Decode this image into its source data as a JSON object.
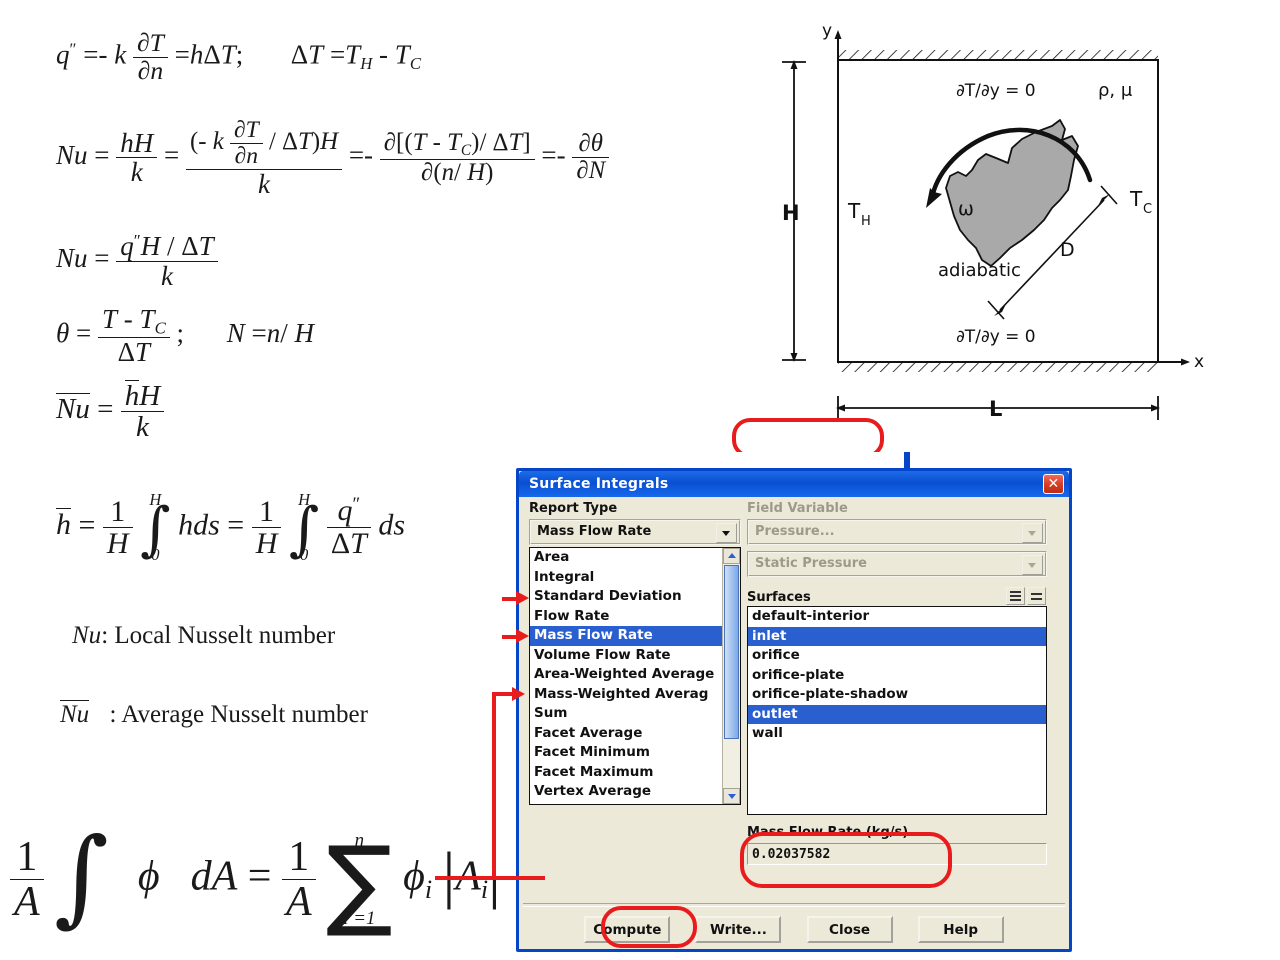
{
  "equations": {
    "eq1": "q″ = -k ∂T/∂n = hΔT;   ΔT = T_H - T_C",
    "eq2": "Nu = hH/k = (-k ∂T/∂n / ΔT)H / k = -∂[(T - T_C)/ΔT] / ∂(n/H) = -∂θ/∂N",
    "eq3": "Nu = q″H/ΔT / k",
    "eq4": "θ = (T - T_C)/ΔT;   N = n/H",
    "eq5": "Nu̅ = h̅H/k",
    "eq6": "h̅ = (1/H)∫₀^H h ds = (1/H)∫₀^H (q″/ΔT) ds",
    "eq7": "(1/A)∫ φ dA = (1/A)Σ_{i=1}^{n} φ_i |A_i|",
    "sym": {
      "q": "q",
      "k": "k",
      "h": "h",
      "H": "H",
      "T": "T",
      "n": "n",
      "N": "N",
      "Nu": "Nu",
      "theta": "θ",
      "dT": "ΔT",
      "partial": "∂",
      "TH": "H",
      "TC": "C",
      "phi": "ϕ",
      "A": "A",
      "ds": "ds",
      "dA": "dA",
      "i": "i",
      "eq": "=",
      "minus": "-",
      "semi": ";",
      "slash": "/",
      "zero": "0",
      "one": "1",
      "ieq1": "i =1",
      "sigma": "∑",
      "integral": "∫",
      "lbr": "[",
      "rbr": "]",
      "lpar": "(",
      "rpar": ")",
      "dprime": "″",
      "plus_minus": "=-"
    }
  },
  "legend": {
    "local": "Local Nusselt number",
    "average": "Average Nusselt number",
    "local_sym": "Nu",
    "average_sym": "Nu",
    "colon": ":"
  },
  "diagram": {
    "axis_y": "y",
    "axis_x": "x",
    "top_bc": "∂T/∂y = 0",
    "bottom_bc": "∂T/∂y = 0",
    "props": "ρ, μ",
    "left_wall": "T",
    "left_wall_sub": "H",
    "right_wall": "T",
    "right_wall_sub": "C",
    "height_label": "H",
    "length_label": "L",
    "diameter_label": "D",
    "omega": "ω",
    "adiabatic": "adiabatic"
  },
  "dialog": {
    "title": "Surface Integrals",
    "close_label": "✕",
    "report_type_label": "Report Type",
    "report_type_value": "Mass Flow Rate",
    "report_type_options": [
      "Area",
      "Integral",
      "Standard Deviation",
      "Flow Rate",
      "Mass Flow Rate",
      "Volume Flow Rate",
      "Area-Weighted Average",
      "Mass-Weighted Averag",
      "Sum",
      "Facet Average",
      "Facet Minimum",
      "Facet Maximum",
      "Vertex Average"
    ],
    "selected_report_type": "Mass Flow Rate",
    "field_variable_label": "Field Variable",
    "field_variable_value": "Pressure...",
    "field_variable_sub_value": "Static Pressure",
    "surfaces_label": "Surfaces",
    "surfaces": [
      "default-interior",
      "inlet",
      "orifice",
      "orifice-plate",
      "orifice-plate-shadow",
      "outlet",
      "wall"
    ],
    "selected_surfaces": [
      "inlet",
      "outlet"
    ],
    "result_label": "Mass Flow Rate (kg/s)",
    "result_value": "0.02037582",
    "buttons": [
      "Compute",
      "Write...",
      "Close",
      "Help"
    ]
  },
  "colors": {
    "dialog_border": "#0546c9",
    "title_bar": "#0a4fd2",
    "selection": "#2a5fd0",
    "annotation_red": "#e81c1c",
    "dialog_face": "#ece9d8",
    "disabled_text": "#9d9a8c"
  }
}
